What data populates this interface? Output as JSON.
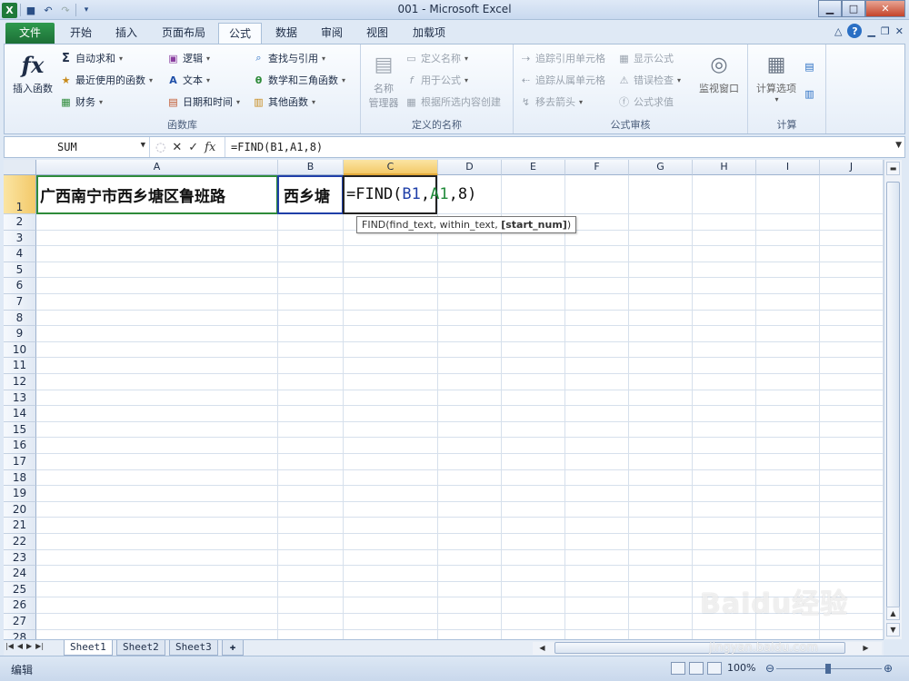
{
  "window": {
    "title": "001 - Microsoft Excel"
  },
  "tabs": [
    "文件",
    "开始",
    "插入",
    "页面布局",
    "公式",
    "数据",
    "审阅",
    "视图",
    "加载项"
  ],
  "active_tab": "公式",
  "ribbon": {
    "function_library": {
      "label": "函数库",
      "insert_function": "插入函数",
      "autosum": "自动求和",
      "recently_used": "最近使用的函数",
      "financial": "财务",
      "logical": "逻辑",
      "text": "文本",
      "date_time": "日期和时间",
      "lookup_reference": "查找与引用",
      "math_trig": "数学和三角函数",
      "more_functions": "其他函数"
    },
    "defined_names": {
      "label": "定义的名称",
      "name_manager_line1": "名称",
      "name_manager_line2": "管理器",
      "define_name": "定义名称",
      "use_in_formula": "用于公式",
      "create_from_selection": "根据所选内容创建"
    },
    "formula_auditing": {
      "label": "公式审核",
      "trace_precedents": "追踪引用单元格",
      "trace_dependents": "追踪从属单元格",
      "remove_arrows": "移去箭头",
      "show_formulas": "显示公式",
      "error_checking": "错误检查",
      "evaluate_formula": "公式求值",
      "watch_window": "监视窗口"
    },
    "calculation": {
      "label": "计算",
      "calculation_options": "计算选项"
    }
  },
  "formula_bar": {
    "name_box": "SUM",
    "fx_label": "fx",
    "formula": "=FIND(B1,A1,8)"
  },
  "sheet": {
    "columns": [
      "A",
      "B",
      "C",
      "D",
      "E",
      "F",
      "G",
      "H",
      "I",
      "J"
    ],
    "rows": [
      "1",
      "2",
      "3",
      "4",
      "5",
      "6",
      "7",
      "8",
      "9",
      "10",
      "11",
      "12",
      "13",
      "14",
      "15",
      "16",
      "17",
      "18",
      "19",
      "20",
      "21",
      "22",
      "23",
      "24",
      "25",
      "26",
      "27",
      "28"
    ],
    "selected_column": "C",
    "selected_row": "1",
    "cells": {
      "A1": "广西南宁市西乡塘区鲁班路",
      "B1": "西乡塘",
      "C1_prefix": "=FIND(",
      "C1_ref_b": "B1",
      "C1_comma1": ",",
      "C1_ref_a": "A1",
      "C1_suffix": ",8)"
    },
    "tooltip_prefix": "FIND(find_text, within_text, ",
    "tooltip_bold": "[start_num]",
    "tooltip_suffix": ")"
  },
  "sheet_tabs": [
    "Sheet1",
    "Sheet2",
    "Sheet3"
  ],
  "status": {
    "mode": "编辑",
    "zoom": "100%"
  },
  "watermark": {
    "brand": "Baidu经验",
    "url": "jingyan.baidu.com"
  }
}
